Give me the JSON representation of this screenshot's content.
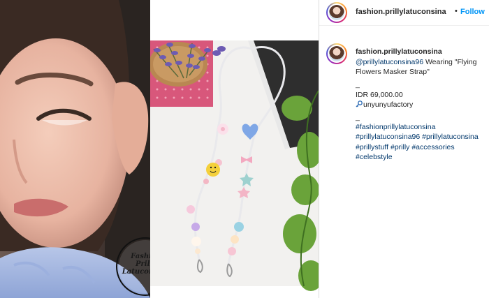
{
  "header": {
    "username": "fashion.prillylatuconsina",
    "separator": "•",
    "follow_label": "Follow"
  },
  "media": {
    "watermark": {
      "line1": "Fashion",
      "line2": "Prilly",
      "line3": "Latuconsina"
    }
  },
  "caption": {
    "username": "fashion.prillylatuconsina",
    "mention": "@prillylatuconsina96",
    "text_1": " Wearing \"Flying",
    "text_2": "Flowers Masker Strap\"",
    "sep_1": "_",
    "price": "IDR 69,000.00",
    "shop": "unyunyufactory",
    "sep_2": "_",
    "tags": [
      "#fashionprillylatuconsina",
      "#prillylatuconsina96 #prillylatuconsina",
      "#prillystuff #prilly #accessories",
      "#celebstyle"
    ]
  },
  "colors": {
    "link_blue": "#00376b",
    "follow_blue": "#0095f6",
    "text": "#262626",
    "divider": "#dbdbdb"
  },
  "icons": {
    "shop": "key-icon"
  }
}
